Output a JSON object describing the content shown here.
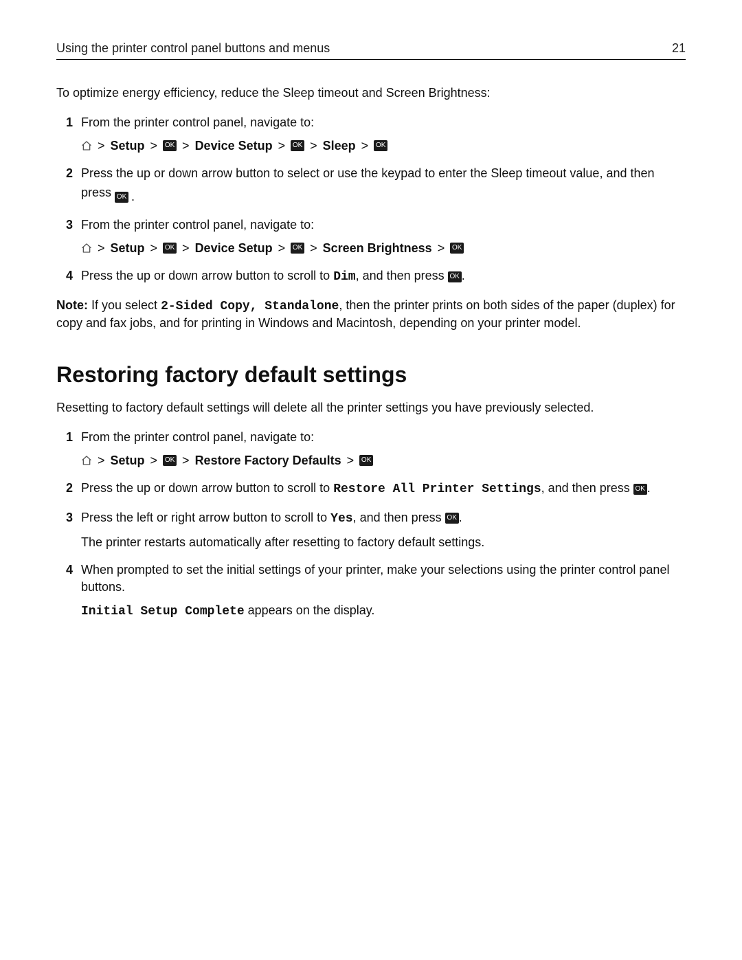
{
  "header": {
    "title": "Using the printer control panel buttons and menus",
    "page_number": "21"
  },
  "intro": "To optimize energy efficiency, reduce the Sleep timeout and Screen Brightness:",
  "icons": {
    "ok_label": "OK",
    "home_label": "Home"
  },
  "nav": {
    "sep": ">",
    "setup": "Setup",
    "device_setup": "Device Setup",
    "sleep": "Sleep",
    "screen_brightness": "Screen Brightness",
    "restore_factory_defaults": "Restore Factory Defaults"
  },
  "steps_a": {
    "s1": {
      "num": "1",
      "text": "From the printer control panel, navigate to:"
    },
    "s2": {
      "num": "2",
      "text_a": "Press the up or down arrow button to select or use the keypad to enter the Sleep timeout value, and then press",
      "text_b": "."
    },
    "s3": {
      "num": "3",
      "text": "From the printer control panel, navigate to:"
    },
    "s4": {
      "num": "4",
      "text_a": "Press the up or down arrow button to scroll to ",
      "code": "Dim",
      "text_b": ", and then press ",
      "text_c": "."
    }
  },
  "note": {
    "label": "Note:",
    "a": " If you select ",
    "code": "2-Sided Copy, Standalone",
    "b": ", then the printer prints on both sides of the paper (duplex) for copy and fax jobs, and for printing in Windows and Macintosh, depending on your printer model."
  },
  "section_b": {
    "heading": "Restoring factory default settings",
    "intro": "Resetting to factory default settings will delete all the printer settings you have previously selected."
  },
  "steps_b": {
    "s1": {
      "num": "1",
      "text": "From the printer control panel, navigate to:"
    },
    "s2": {
      "num": "2",
      "text_a": "Press the up or down arrow button to scroll to ",
      "code": "Restore All Printer Settings",
      "text_b": ", and then press ",
      "text_c": "."
    },
    "s3": {
      "num": "3",
      "text_a": "Press the left or right arrow button to scroll to ",
      "code": "Yes",
      "text_b": ", and then press ",
      "text_c": ".",
      "sub": "The printer restarts automatically after resetting to factory default settings."
    },
    "s4": {
      "num": "4",
      "text": "When prompted to set the initial settings of your printer, make your selections using the printer control panel buttons.",
      "sub_code": "Initial Setup Complete",
      "sub_text": " appears on the display."
    }
  }
}
